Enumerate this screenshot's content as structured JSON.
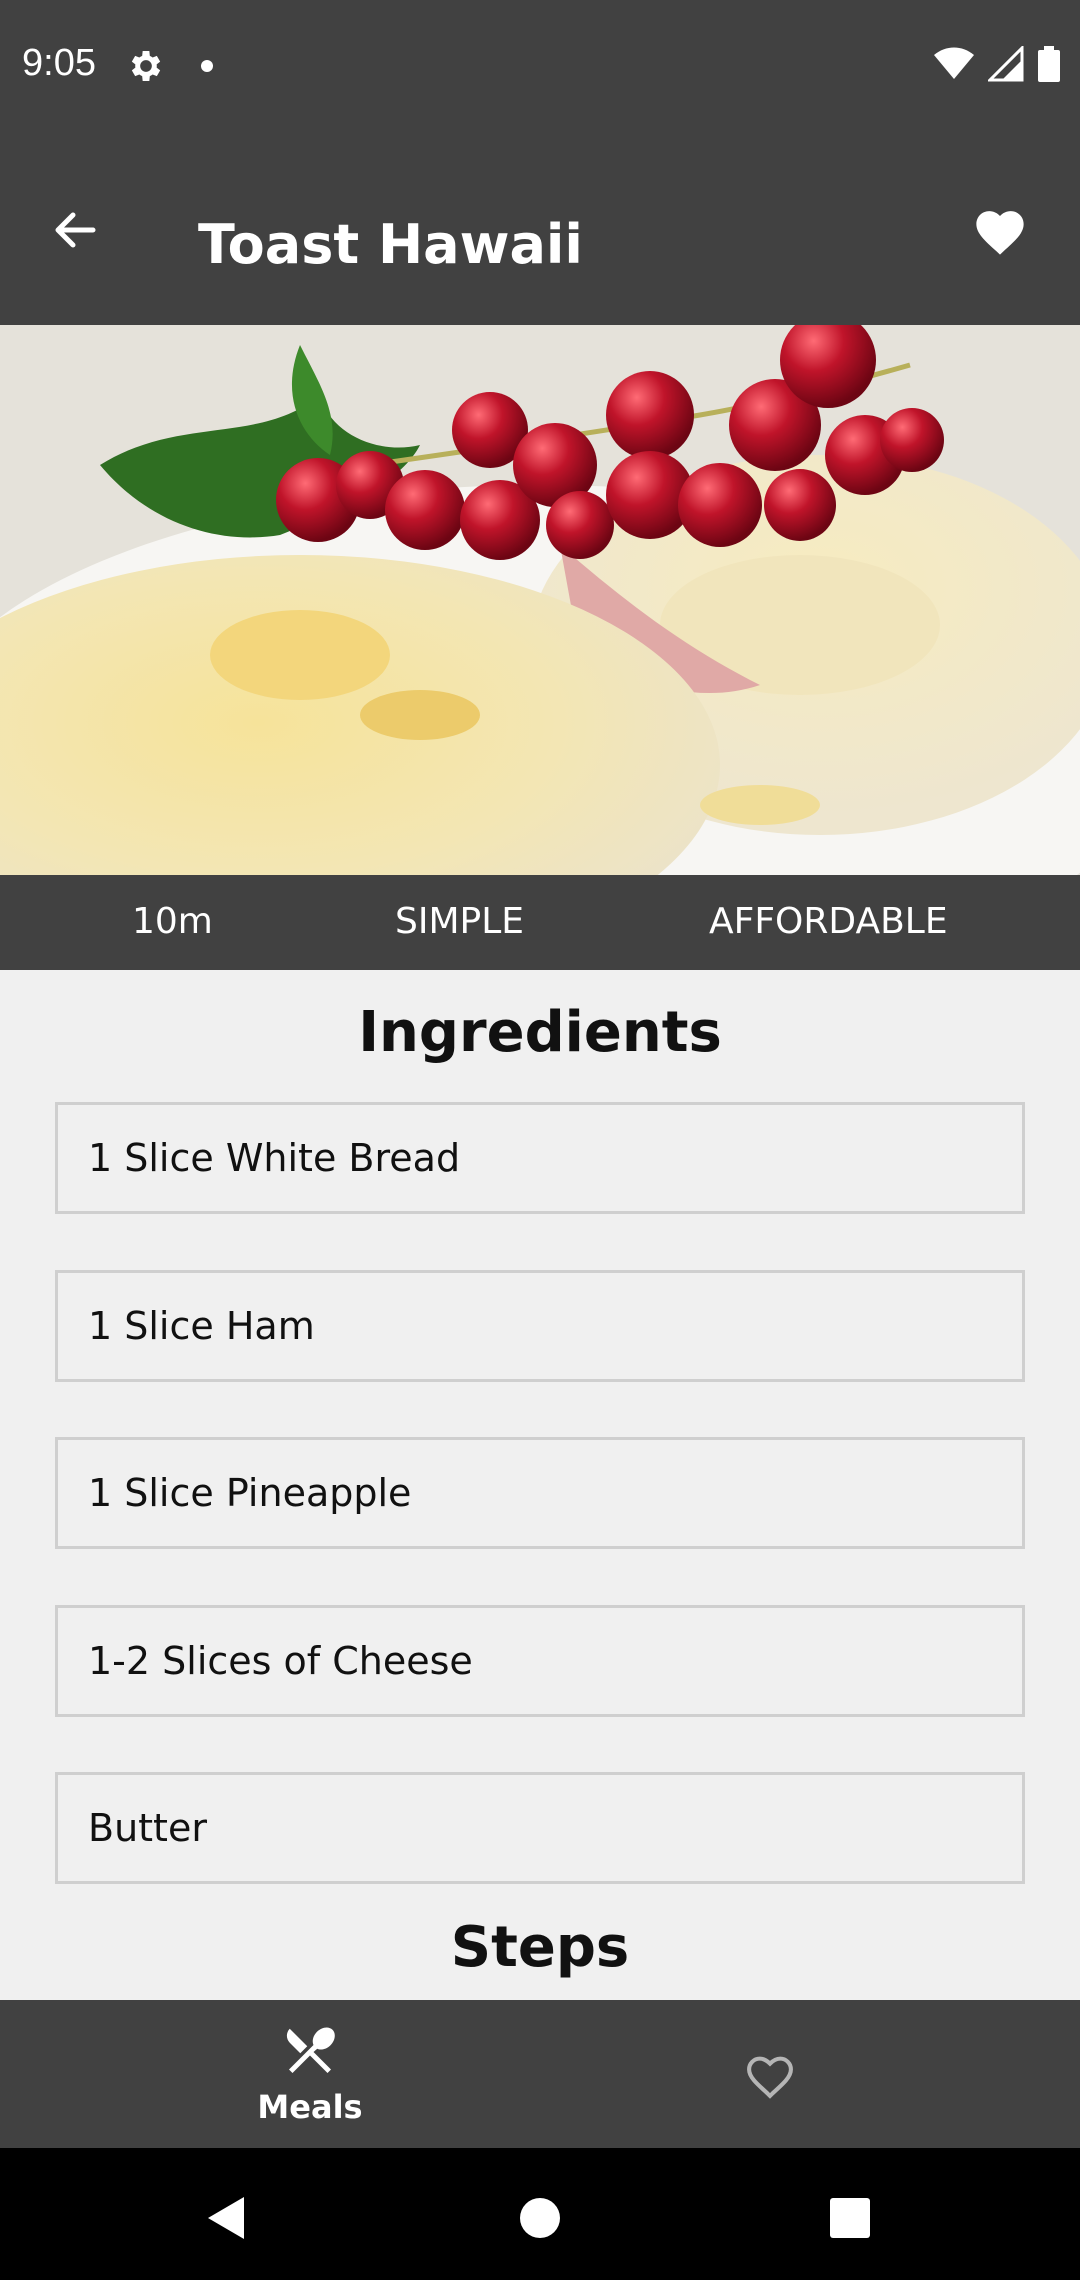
{
  "status_bar": {
    "time": "9:05"
  },
  "app_bar": {
    "title": "Toast Hawaii"
  },
  "meta": {
    "duration": "10m",
    "complexity": "SIMPLE",
    "affordability": "AFFORDABLE"
  },
  "ingredients_title": "Ingredients",
  "ingredients": [
    "1 Slice White Bread",
    "1 Slice Ham",
    "1 Slice Pineapple",
    "1-2 Slices of Cheese",
    "Butter"
  ],
  "steps_title": "Steps",
  "bottom_nav": {
    "meals_label": "Meals"
  },
  "colors": {
    "bar": "#414141",
    "background": "#f0f0f0"
  }
}
